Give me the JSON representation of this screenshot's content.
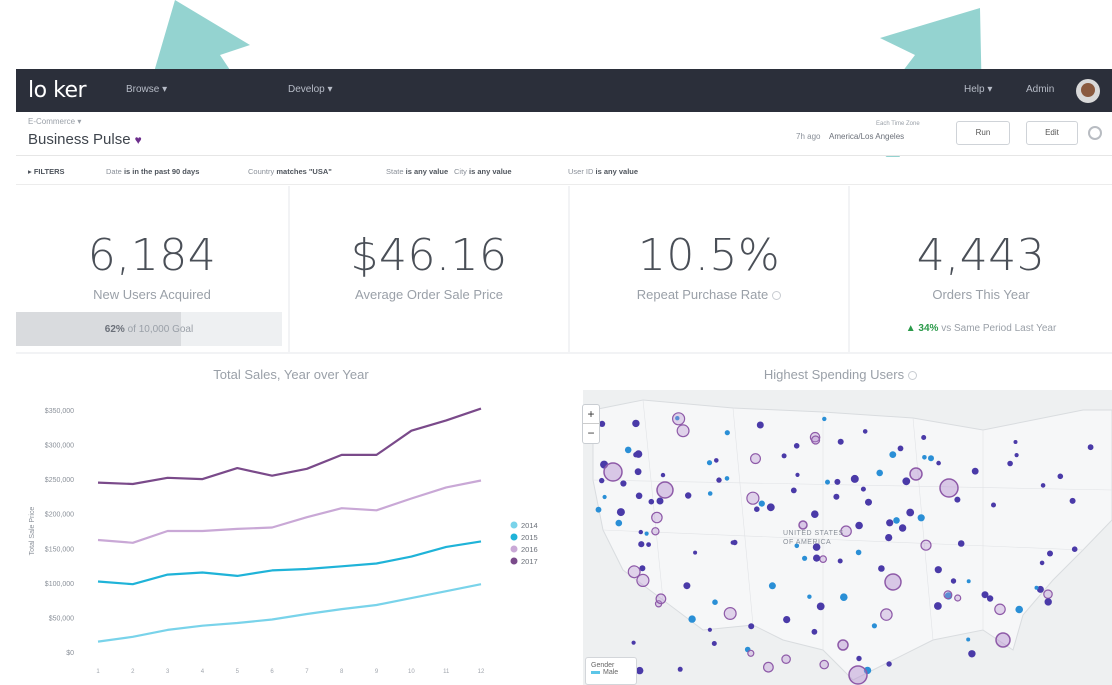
{
  "nav": {
    "logo": "lo ker",
    "items": [
      "Browse ▾",
      "Develop ▾"
    ],
    "right_items": [
      "Help ▾",
      "Admin"
    ]
  },
  "header": {
    "breadcrumb": "E-Commerce ▾",
    "title": "Business Pulse",
    "heart": "♥",
    "ago": "7h ago",
    "tz_label": "Each Time Zone",
    "tz_value": "America/Los Angeles",
    "run_label": "Run",
    "edit_label": "Edit"
  },
  "filters": {
    "toggle_label": "▸ FILTERS",
    "items": [
      {
        "field": "Date",
        "op": "is in the past 90 days"
      },
      {
        "field": "Country",
        "op": "matches \"USA\""
      },
      {
        "field": "State",
        "op": "is any value"
      },
      {
        "field": "City",
        "op": "is any value"
      },
      {
        "field": "User ID",
        "op": "is any value"
      }
    ]
  },
  "tiles": [
    {
      "value": "6,184",
      "label": "New Users Acquired",
      "goal_pct": "62%",
      "goal_text": "of 10,000 Goal",
      "goal_fraction": 0.62
    },
    {
      "value": "$46.16",
      "label": "Average Order Sale Price"
    },
    {
      "value": "10.5%",
      "label": "Repeat Purchase Rate"
    },
    {
      "value": "4,443",
      "label": "Orders This Year",
      "change": "▲ 34%",
      "change_text": "vs Same Period Last Year"
    }
  ],
  "sales_chart_title": "Total Sales, Year over Year",
  "map": {
    "title": "Highest Spending Users",
    "zoom_in": "+",
    "zoom_out": "−",
    "country_label_1": "UNITED STATES",
    "country_label_2": "OF AMERICA",
    "legend_title": "Gender",
    "legend_item": "Male"
  },
  "colors": {
    "accent": "#6c2e8c",
    "nav_bg": "#2b2f3a",
    "arrow": "#94d3d0",
    "series_2014": "#79d3ea",
    "series_2015": "#1fb3d8",
    "series_2016": "#c9a8d6",
    "series_2017": "#7a4a8a"
  },
  "chart_data": {
    "type": "line",
    "title": "Total Sales, Year over Year",
    "xlabel": "",
    "ylabel": "Total Sale Price",
    "ylim": [
      0,
      350000
    ],
    "yticks": [
      "$0",
      "$50,000",
      "$100,000",
      "$150,000",
      "$200,000",
      "$250,000",
      "$300,000",
      "$350,000"
    ],
    "x": [
      1,
      2,
      3,
      4,
      5,
      6,
      7,
      8,
      9,
      10,
      11,
      12
    ],
    "legend_position": "right",
    "series": [
      {
        "name": "2014",
        "color": "#79d3ea",
        "values": [
          15000,
          22000,
          32000,
          38000,
          42000,
          47000,
          55000,
          62000,
          68000,
          78000,
          88000,
          98000
        ]
      },
      {
        "name": "2015",
        "color": "#1fb3d8",
        "values": [
          102000,
          98000,
          112000,
          115000,
          110000,
          118000,
          120000,
          124000,
          128000,
          138000,
          152000,
          160000
        ]
      },
      {
        "name": "2016",
        "color": "#c9a8d6",
        "values": [
          162000,
          158000,
          175000,
          175000,
          178000,
          180000,
          195000,
          208000,
          205000,
          222000,
          238000,
          248000
        ]
      },
      {
        "name": "2017",
        "color": "#7a4a8a",
        "values": [
          245000,
          243000,
          252000,
          250000,
          266000,
          255000,
          265000,
          285000,
          285000,
          320000,
          335000,
          352000
        ]
      }
    ]
  }
}
